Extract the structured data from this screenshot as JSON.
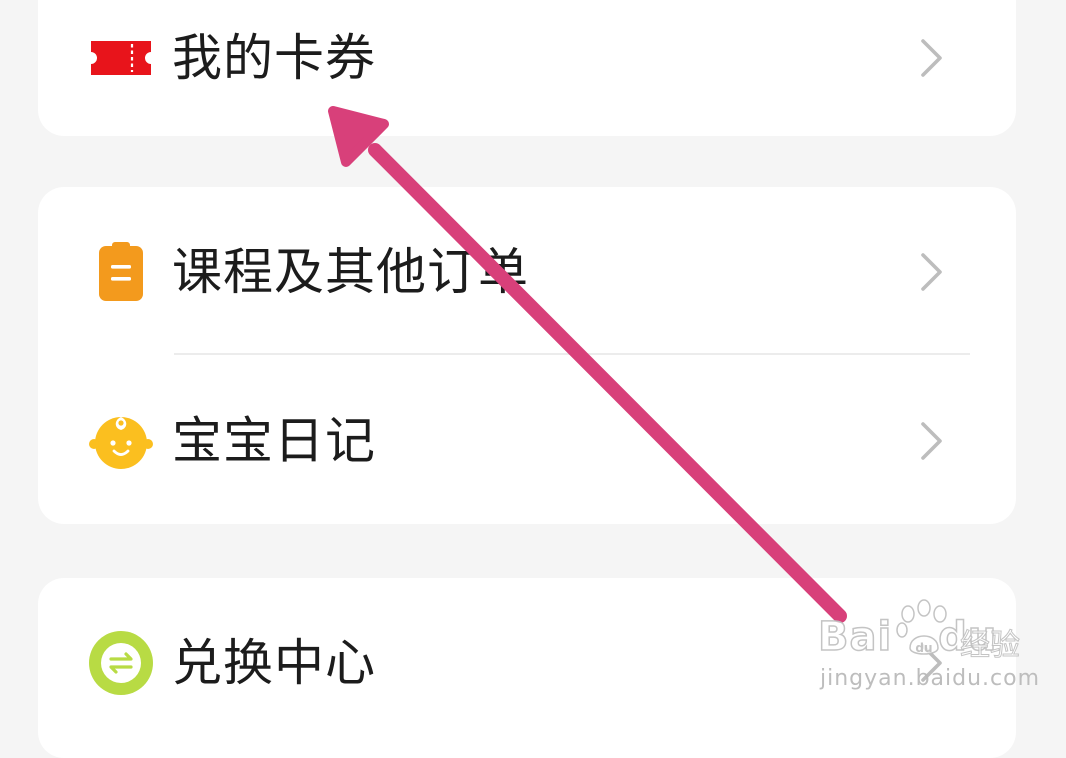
{
  "menu": {
    "card1": [
      {
        "label": "我的卡券",
        "icon": "ticket-icon",
        "icon_color": "#e8141b"
      }
    ],
    "card2": [
      {
        "label": "课程及其他订单",
        "icon": "clipboard-icon",
        "icon_color": "#f39a1d"
      },
      {
        "label": "宝宝日记",
        "icon": "baby-face-icon",
        "icon_color": "#fbbf1f"
      }
    ],
    "card3": [
      {
        "label": "兑换中心",
        "icon": "exchange-icon",
        "icon_color": "#b8db44"
      }
    ]
  },
  "annotation": {
    "type": "arrow",
    "color": "#d8407a"
  },
  "watermark": {
    "brand_left": "Bai",
    "brand_right": "du",
    "jingyan": "经验",
    "url": "jingyan.baidu.com"
  },
  "colors": {
    "background": "#f5f5f5",
    "card": "#ffffff",
    "text": "#1c1c1c",
    "chevron": "#bdbdbd"
  }
}
